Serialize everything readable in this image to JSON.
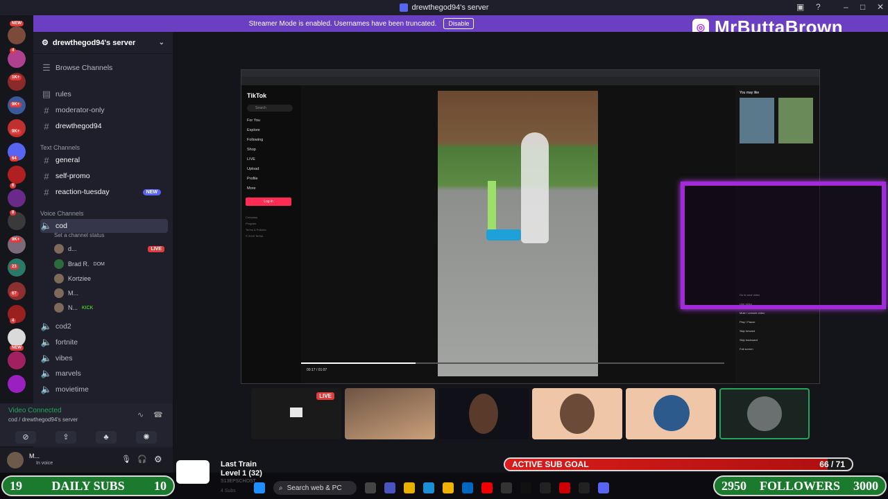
{
  "window": {
    "title": "drewthegod94's server"
  },
  "banner": {
    "text": "Streamer Mode is enabled. Usernames have been truncated.",
    "button": "Disable"
  },
  "brand": {
    "name": "MrButtaBrown"
  },
  "rail_badges": [
    "NEW",
    "4",
    "1K+",
    "9K+",
    "9K+",
    "64",
    "6",
    "8",
    "9K+",
    "23",
    "67",
    "4",
    "NEW"
  ],
  "sidebar": {
    "server_name": "drewthegod94's server",
    "browse": "Browse Channels",
    "channels": [
      {
        "name": "rules"
      },
      {
        "name": "moderator-only"
      },
      {
        "name": "drewthegod94"
      }
    ],
    "text_category": "Text Channels",
    "text_channels": [
      {
        "name": "general"
      },
      {
        "name": "self-promo"
      },
      {
        "name": "reaction-tuesday",
        "badge": "NEW"
      }
    ],
    "voice_category": "Voice Channels",
    "voice_active": {
      "name": "cod",
      "status": "Set a channel status"
    },
    "voice_users": [
      {
        "name": "d...",
        "tag": "LIVE"
      },
      {
        "name": "Brad R.",
        "tag": "DOM"
      },
      {
        "name": "Kortziee"
      },
      {
        "name": "M..."
      },
      {
        "name": "N...",
        "tag": "KICK"
      }
    ],
    "voice_channels": [
      "cod2",
      "fortnite",
      "vibes",
      "marvels",
      "movietime"
    ]
  },
  "voice_connected": {
    "title": "Video Connected",
    "subtitle": "cod / drewthegod94's server"
  },
  "user": {
    "name": "M...",
    "status": "In voice"
  },
  "tiktok": {
    "logo": "TikTok",
    "search": "Search",
    "nav": [
      "For You",
      "Explore",
      "Following",
      "Shop",
      "LIVE",
      "Upload",
      "Profile",
      "More"
    ],
    "login": "Log in",
    "footer": [
      "Company",
      "Program",
      "Terms & Policies",
      "© 2025 TikTok"
    ],
    "you_may_like": "You may like",
    "time": "00:17 / 01:07",
    "menu": [
      "Go to next video",
      "Like video",
      "Mute / unmute video",
      "Play / Pause",
      "Skip forward",
      "Skip backward",
      "Full screen"
    ]
  },
  "tiles": [
    {
      "live": "LIVE"
    },
    {},
    {},
    {},
    {},
    {}
  ],
  "subs": {
    "left_num": "19",
    "label": "DAILY SUBS",
    "right_num": "10"
  },
  "followers": {
    "left_num": "2950",
    "label": "FOLLOWERS",
    "right_num": "3000"
  },
  "goal": {
    "label": "ACTIVE SUB GOAL",
    "count": "66 / 71",
    "progress": 0.93
  },
  "track": {
    "title": "Last Train",
    "level": "Level 1 (32)",
    "sub": "S13EPSCHOST",
    "subs": "4 Subs"
  },
  "taskbar": {
    "search": "Search web & PC"
  },
  "colors": {
    "banner": "#6b3fc2",
    "live": "#e23b3b",
    "frame": "#a22ad8",
    "subs": "#1c7a2e"
  }
}
